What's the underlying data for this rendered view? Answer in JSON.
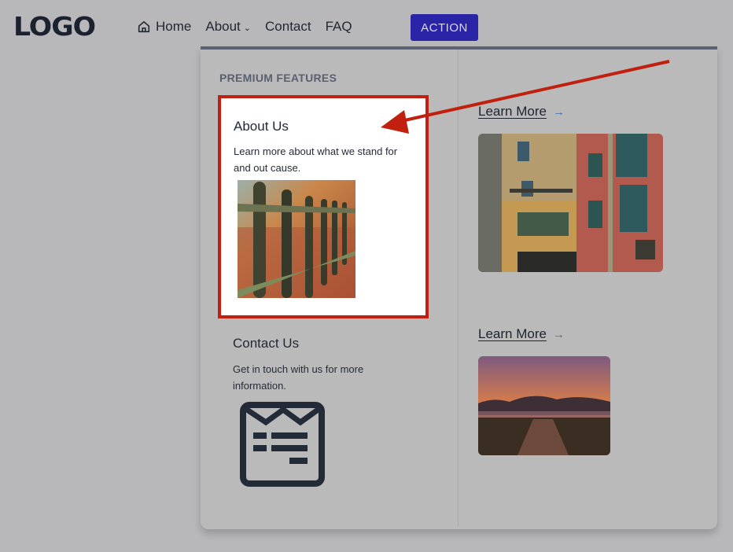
{
  "header": {
    "logo": "LOGO",
    "nav": [
      {
        "label": "Home",
        "icon": "home-icon"
      },
      {
        "label": "About",
        "icon": "chevron-down-icon"
      },
      {
        "label": "Contact"
      },
      {
        "label": "FAQ"
      }
    ],
    "chevron": "⌄",
    "action_label": "ACTION"
  },
  "dropdown": {
    "section_title": "PREMIUM FEATURES",
    "cards": [
      {
        "title": "About Us",
        "description": "Learn more about what we stand for and out cause.",
        "image": "fence-photo"
      },
      {
        "title": "Contact Us",
        "description": "Get in touch with us for more information.",
        "icon": "contact-form-icon"
      }
    ],
    "links": [
      {
        "label": "Learn More",
        "arrow": "→",
        "image": "city-buildings-photo"
      },
      {
        "label": "Learn More",
        "arrow": "→",
        "image": "sunset-path-photo"
      }
    ]
  },
  "annotation": {
    "type": "red-arrow-and-highlight-box",
    "color": "#c1200f"
  },
  "colors": {
    "action_button": "#2a24a6",
    "panel_top_border": "#5b6274",
    "highlight": "#c1200f",
    "link_arrow": "#3f6fae"
  }
}
